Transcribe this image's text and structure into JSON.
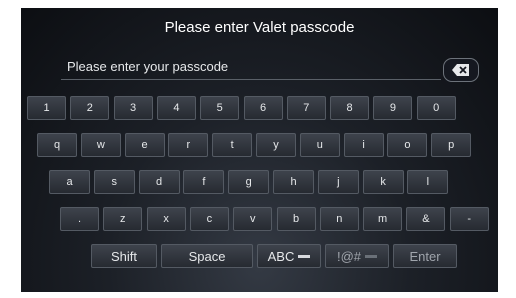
{
  "title": "Please enter Valet passcode",
  "input": {
    "placeholder": "Please enter your passcode"
  },
  "rows": [
    [
      "1",
      "2",
      "3",
      "4",
      "5",
      "6",
      "7",
      "8",
      "9",
      "0"
    ],
    [
      "q",
      "w",
      "e",
      "r",
      "t",
      "y",
      "u",
      "i",
      "o",
      "p"
    ],
    [
      "a",
      "s",
      "d",
      "f",
      "g",
      "h",
      "j",
      "k",
      "l"
    ],
    [
      ".",
      "z",
      "x",
      "c",
      "v",
      "b",
      "n",
      "m",
      "&",
      "-"
    ]
  ],
  "bottom_row": {
    "shift": "Shift",
    "space": "Space",
    "abc": "ABC",
    "symbols": "!@#",
    "enter": "Enter"
  },
  "icons": {
    "backspace": "backspace-icon"
  }
}
